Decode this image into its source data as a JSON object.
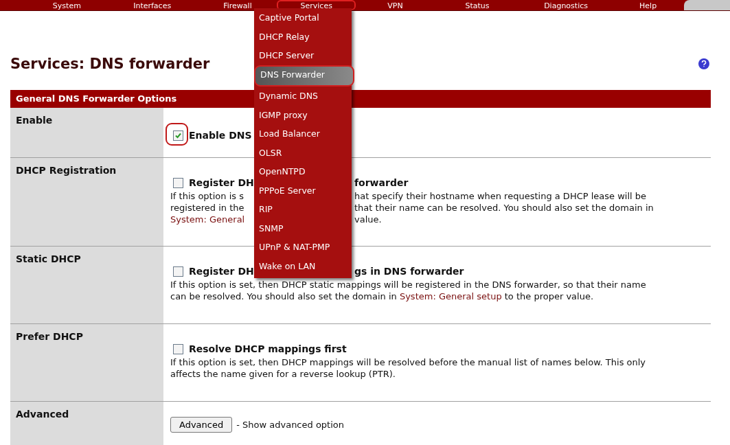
{
  "nav": {
    "items": [
      {
        "label": "System",
        "selected": false
      },
      {
        "label": "Interfaces",
        "selected": false
      },
      {
        "label": "Firewall",
        "selected": false
      },
      {
        "label": "Services",
        "selected": true
      },
      {
        "label": "VPN",
        "selected": false
      },
      {
        "label": "Status",
        "selected": false
      },
      {
        "label": "Diagnostics",
        "selected": false
      },
      {
        "label": "Help",
        "selected": false
      }
    ]
  },
  "menu": {
    "items": [
      {
        "label": "Captive Portal",
        "selected": false
      },
      {
        "label": "DHCP Relay",
        "selected": false
      },
      {
        "label": "DHCP Server",
        "selected": false
      },
      {
        "label": "DNS Forwarder",
        "selected": true
      },
      {
        "label": "Dynamic DNS",
        "selected": false
      },
      {
        "label": "IGMP proxy",
        "selected": false
      },
      {
        "label": "Load Balancer",
        "selected": false
      },
      {
        "label": "OLSR",
        "selected": false
      },
      {
        "label": "OpenNTPD",
        "selected": false
      },
      {
        "label": "PPPoE Server",
        "selected": false
      },
      {
        "label": "RIP",
        "selected": false
      },
      {
        "label": "SNMP",
        "selected": false
      },
      {
        "label": "UPnP & NAT-PMP",
        "selected": false
      },
      {
        "label": "Wake on LAN",
        "selected": false
      }
    ]
  },
  "page": {
    "title": "Services: DNS forwarder"
  },
  "section": {
    "title": "General DNS Forwarder Options"
  },
  "rows": [
    {
      "label": "Enable",
      "kind": "checkbox",
      "checked": true,
      "highlighted": true,
      "option": {
        "before": "Enable DNS"
      },
      "description": []
    },
    {
      "label": "DHCP Registration",
      "kind": "checkbox",
      "checked": false,
      "highlighted": false,
      "option": {
        "before": "Register DH",
        "after": "forwarder"
      },
      "description": [
        {
          "before": [
            {
              "text": "If this option is s",
              "link": false
            }
          ],
          "after": [
            {
              "text": "hat specify their hostname when requesting a DHCP lease will be",
              "link": false
            }
          ]
        },
        {
          "before": [
            {
              "text": "registered in the",
              "link": false
            }
          ],
          "after": [
            {
              "text": "that their name can be resolved. You should also set the domain in",
              "link": false
            }
          ]
        },
        {
          "before": [
            {
              "text": "System: General",
              "link": true
            }
          ],
          "after": [
            {
              "text": "value.",
              "link": false
            }
          ]
        }
      ]
    },
    {
      "label": "Static DHCP",
      "kind": "checkbox",
      "checked": false,
      "highlighted": false,
      "option": {
        "before": "Register DH",
        "after": "gs in DNS forwarder"
      },
      "description": [
        {
          "before": [
            {
              "text": "If this option is set, then DHCP static mappings will be registered in the DNS forwarder, so that their name",
              "link": false
            }
          ]
        },
        {
          "before": [
            {
              "text": "can be resolved. You should also set the domain in ",
              "link": false
            },
            {
              "text": "System: General setup",
              "link": true
            },
            {
              "text": " to the proper value.",
              "link": false
            }
          ]
        }
      ]
    },
    {
      "label": "Prefer DHCP",
      "kind": "checkbox",
      "checked": false,
      "highlighted": false,
      "option": {
        "before": "Resolve DHCP mappings first"
      },
      "description": [
        {
          "before": [
            {
              "text": "If this option is set, then DHCP mappings will be resolved before the manual list of names below. This only",
              "link": false
            }
          ]
        },
        {
          "before": [
            {
              "text": "affects the name given for a reverse lookup (PTR).",
              "link": false
            }
          ]
        }
      ]
    },
    {
      "label": "Advanced",
      "kind": "button",
      "button": "Advanced",
      "note": "- Show advanced option"
    }
  ]
}
